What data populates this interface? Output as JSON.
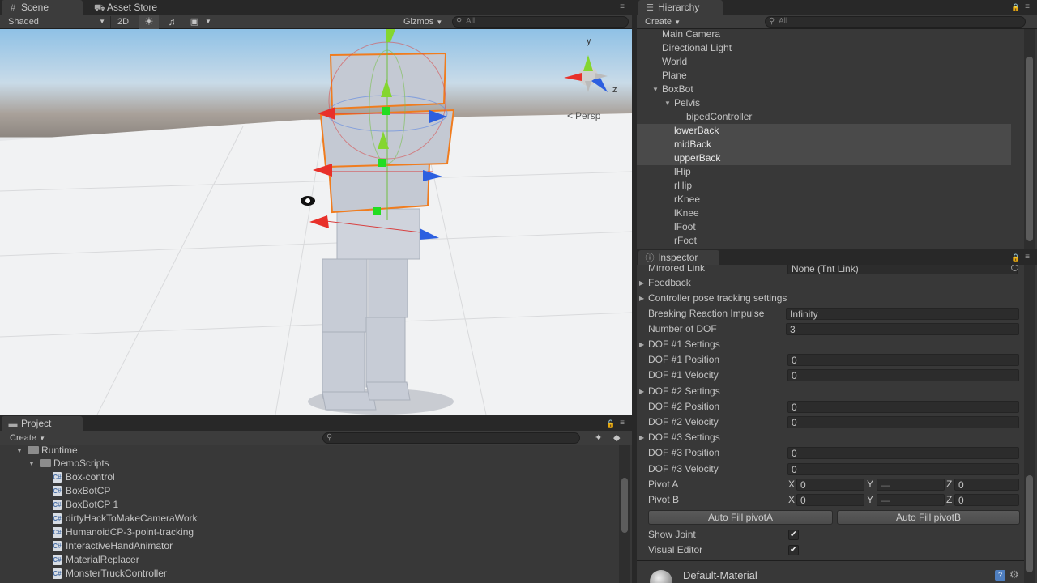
{
  "scene": {
    "tabs": [
      {
        "label": "Scene",
        "icon": "grid-icon"
      },
      {
        "label": "Asset Store",
        "icon": "store-icon"
      }
    ],
    "shading_mode": "Shaded",
    "mode_2d": "2D",
    "gizmos_label": "Gizmos",
    "search_placeholder": "All",
    "persp_label": "Persp",
    "gizmo_axes": {
      "y": "y",
      "z": "z"
    },
    "colors": {
      "selection_outline": "#f07c1e",
      "x_axis": "#e8302a",
      "y_axis": "#84d62f",
      "z_axis": "#2c5fe0"
    }
  },
  "hierarchy": {
    "tab_label": "Hierarchy",
    "create_label": "Create",
    "search_placeholder": "All",
    "items": [
      {
        "label": "Main Camera"
      },
      {
        "label": "Directional Light"
      },
      {
        "label": "World"
      },
      {
        "label": "Plane"
      },
      {
        "label": "BoxBot"
      },
      {
        "label": "Pelvis"
      },
      {
        "label": "bipedController"
      },
      {
        "label": "lowerBack"
      },
      {
        "label": "midBack"
      },
      {
        "label": "upperBack"
      },
      {
        "label": "lHip"
      },
      {
        "label": "rHip"
      },
      {
        "label": "rKnee"
      },
      {
        "label": "lKnee"
      },
      {
        "label": "lFoot"
      },
      {
        "label": "rFoot"
      }
    ]
  },
  "inspector": {
    "tab_label": "Inspector",
    "mirrored_link": {
      "label": "Mirrored Link",
      "value": "None (Tnt Link)"
    },
    "feedback_label": "Feedback",
    "controller_pose_label": "Controller pose tracking settings",
    "breaking_impulse": {
      "label": "Breaking Reaction Impulse",
      "value": "Infinity"
    },
    "number_of_dof": {
      "label": "Number of DOF",
      "value": "3"
    },
    "dof": [
      {
        "settings": "DOF #1 Settings",
        "position_label": "DOF #1 Position",
        "position": "0",
        "velocity_label": "DOF #1 Velocity",
        "velocity": "0"
      },
      {
        "settings": "DOF #2 Settings",
        "position_label": "DOF #2 Position",
        "position": "0",
        "velocity_label": "DOF #2 Velocity",
        "velocity": "0"
      },
      {
        "settings": "DOF #3 Settings",
        "position_label": "DOF #3 Position",
        "position": "0",
        "velocity_label": "DOF #3 Velocity",
        "velocity": "0"
      }
    ],
    "pivot_a": {
      "label": "Pivot A",
      "x_label": "X",
      "x": "0",
      "y_label": "Y",
      "y": "—",
      "z_label": "Z",
      "z": "0"
    },
    "pivot_b": {
      "label": "Pivot B",
      "x_label": "X",
      "x": "0",
      "y_label": "Y",
      "y": "—",
      "z_label": "Z",
      "z": "0"
    },
    "auto_fill_a": "Auto Fill pivotA",
    "auto_fill_b": "Auto Fill pivotB",
    "show_joint": {
      "label": "Show Joint",
      "checked": "✔"
    },
    "visual_editor": {
      "label": "Visual Editor",
      "checked": "✔"
    },
    "material_name": "Default-Material"
  },
  "project": {
    "tab_label": "Project",
    "create_label": "Create",
    "tree": [
      {
        "label": "Runtime",
        "kind": "folder"
      },
      {
        "label": "DemoScripts",
        "kind": "folder"
      },
      {
        "label": "Box-control",
        "kind": "script"
      },
      {
        "label": "BoxBotCP",
        "kind": "script"
      },
      {
        "label": "BoxBotCP 1",
        "kind": "script"
      },
      {
        "label": "dirtyHackToMakeCameraWork",
        "kind": "script"
      },
      {
        "label": "HumanoidCP-3-point-tracking",
        "kind": "script"
      },
      {
        "label": "InteractiveHandAnimator",
        "kind": "script"
      },
      {
        "label": "MaterialReplacer",
        "kind": "script"
      },
      {
        "label": "MonsterTruckController",
        "kind": "script"
      }
    ]
  }
}
